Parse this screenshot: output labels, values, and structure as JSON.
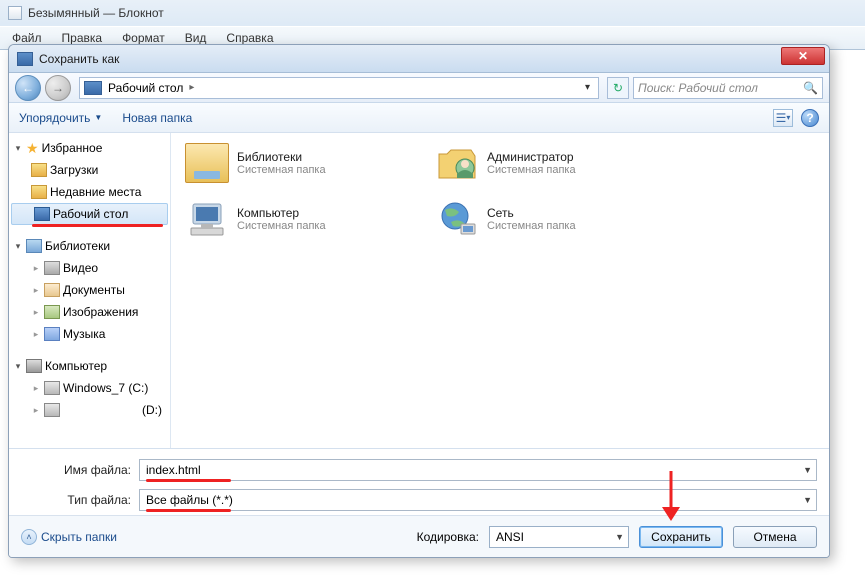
{
  "notepad": {
    "title": "Безымянный — Блокнот",
    "menu": [
      "Файл",
      "Правка",
      "Формат",
      "Вид",
      "Справка"
    ]
  },
  "dialog": {
    "title": "Сохранить как",
    "breadcrumb": {
      "location": "Рабочий стол"
    },
    "search_placeholder": "Поиск: Рабочий стол",
    "toolbar": {
      "organize": "Упорядочить",
      "newfolder": "Новая папка"
    },
    "sidebar": {
      "favorites": "Избранное",
      "downloads": "Загрузки",
      "recent": "Недавние места",
      "desktop": "Рабочий стол",
      "libraries": "Библиотеки",
      "video": "Видео",
      "documents": "Документы",
      "pictures": "Изображения",
      "music": "Музыка",
      "computer": "Компьютер",
      "drive_c": "Windows_7 (C:)",
      "drive_d": "(D:)"
    },
    "items": [
      {
        "name": "Библиотеки",
        "sub": "Системная папка"
      },
      {
        "name": "Администратор",
        "sub": "Системная папка"
      },
      {
        "name": "Компьютер",
        "sub": "Системная папка"
      },
      {
        "name": "Сеть",
        "sub": "Системная папка"
      }
    ],
    "filename_label": "Имя файла:",
    "filename_value": "index.html",
    "filetype_label": "Тип файла:",
    "filetype_value": "Все файлы  (*.*)",
    "hide_folders": "Скрыть папки",
    "encoding_label": "Кодировка:",
    "encoding_value": "ANSI",
    "save": "Сохранить",
    "cancel": "Отмена"
  }
}
